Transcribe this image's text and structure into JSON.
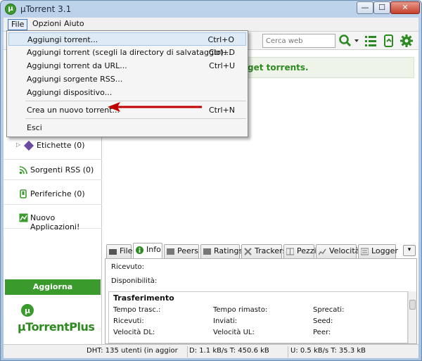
{
  "window": {
    "title": "µTorrent 3.1",
    "logo_letter": "µ",
    "min": "—",
    "max": "☐",
    "close": "✕"
  },
  "menubar": {
    "file": "File",
    "options": "Opzioni",
    "help": "Aiuto"
  },
  "toolbar": {
    "search_placeholder": "Cerca web"
  },
  "file_menu": {
    "items": [
      {
        "label": "Aggiungi torrent...",
        "shortcut": "Ctrl+O"
      },
      {
        "label": "Aggiungi torrent (scegli la directory di salvataggio)...",
        "shortcut": "Ctrl+D"
      },
      {
        "label": "Aggiungi torrent da URL...",
        "shortcut": "Ctrl+U"
      },
      {
        "label": "Aggiungi sorgente RSS...",
        "shortcut": ""
      },
      {
        "label": "Aggiungi dispositivo...",
        "shortcut": ""
      },
      {
        "label": "Crea un nuovo torrent...",
        "shortcut": "Ctrl+N"
      },
      {
        "label": "Esci",
        "shortcut": ""
      }
    ]
  },
  "sidebar": {
    "labels": "Etichette (0)",
    "rss": "Sorgenti RSS (0)",
    "devices": "Periferiche (0)",
    "apps": "Nuovo Applicazioni!",
    "upgrade": "Aggiorna",
    "plus_logo": "µTorrentPlus"
  },
  "main": {
    "promo": "get torrents."
  },
  "tabs": [
    "File",
    "Info",
    "Peers",
    "Ratings",
    "Trackers",
    "Pezzi",
    "Velocità",
    "Logger"
  ],
  "info": {
    "received": "Ricevuto:",
    "availability": "Disponibilità:",
    "transfer_title": "Trasferimento",
    "fields": {
      "elapsed": "Tempo trasc.:",
      "remaining": "Tempo rimasto:",
      "wasted": "Sprecati:",
      "downloaded": "Ricevuti:",
      "uploaded": "Inviati:",
      "seeds": "Seed:",
      "dl_speed": "Velocità DL:",
      "ul_speed": "Velocità UL:",
      "peers": "Peer:"
    }
  },
  "statusbar": {
    "dht": "DHT: 135 utenti (in aggior",
    "down": "D: 1.1 kB/s T: 450.6 kB",
    "up": "U: 0.5 kB/s T: 35.3 kB"
  },
  "colors": {
    "accent_green": "#3a9a2c",
    "highlight_red": "#c00000"
  }
}
